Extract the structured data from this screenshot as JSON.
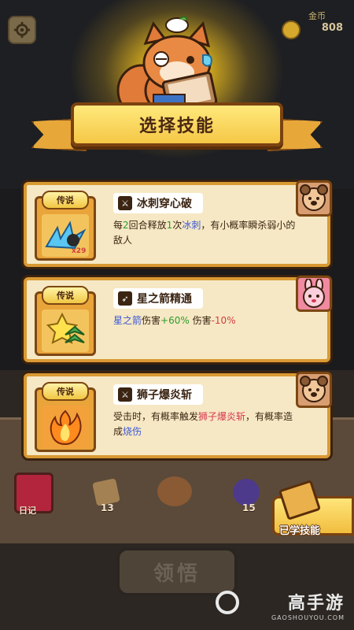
{
  "header": {
    "gold_label": "金币",
    "gold_value": "808"
  },
  "title": "选择技能",
  "skills": [
    {
      "rarity": "传说",
      "name": "冰刺穿心破",
      "icon_badge": "x29",
      "desc_parts": [
        "每",
        "2",
        "回合释放",
        "1",
        "次",
        "冰刺",
        "，有小概率瞬杀弱小的敌人"
      ],
      "avatar": "bear-avatar"
    },
    {
      "rarity": "传说",
      "name": "星之箭精通",
      "desc_parts": [
        "星之箭",
        "伤害",
        "+60%",
        " 伤害",
        "-10%"
      ],
      "avatar": "bunny-avatar"
    },
    {
      "rarity": "传说",
      "name": "狮子爆炎斩",
      "desc_parts": [
        "受击时，有概率触发",
        "狮子爆炎斩",
        "，有概率造成",
        "烧伤"
      ],
      "avatar": "bear-avatar"
    }
  ],
  "floor": {
    "diary_label": "日记",
    "stat_a": "13",
    "stat_b": "15"
  },
  "learned_button": "已学技能",
  "claim_button": "领悟",
  "watermark": {
    "main": "高手游",
    "sub": "GAOSHOUYOU.COM"
  },
  "colors": {
    "card_bg": "#f6e8c4",
    "card_border": "#d99933",
    "banner": "#f5c746",
    "highlight_green": "#2d9b2d",
    "highlight_blue": "#3b57d6",
    "highlight_red": "#d13e3e"
  }
}
